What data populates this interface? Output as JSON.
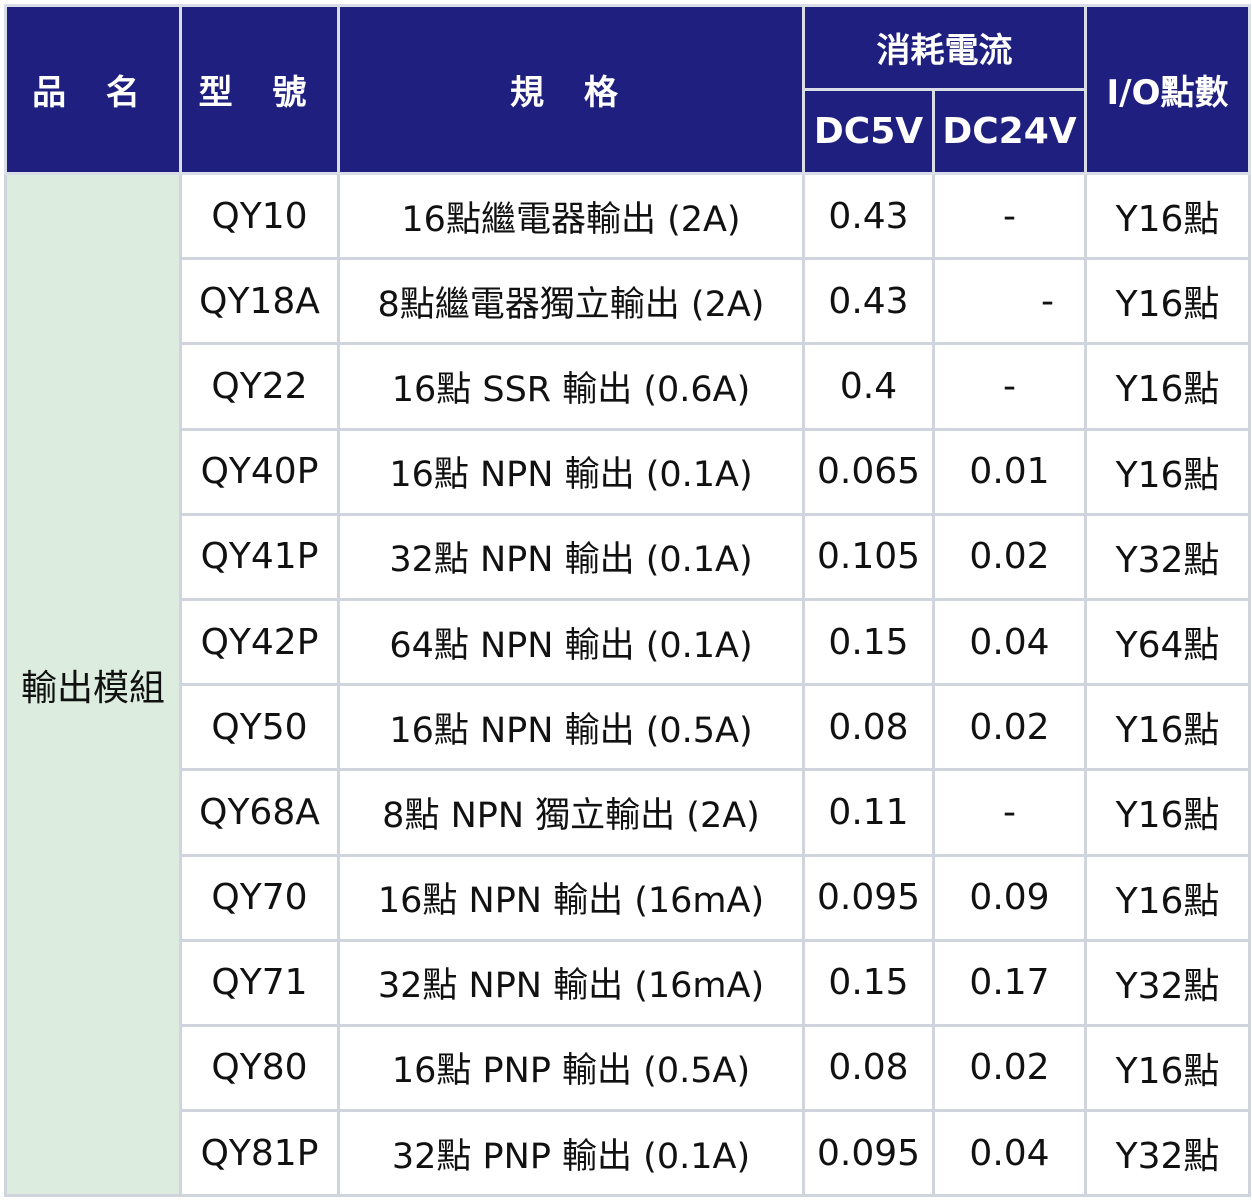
{
  "headers": {
    "product_name": "品 名",
    "model": "型 號",
    "spec": "規 格",
    "current": "消耗電流",
    "dc5v": "DC5V",
    "dc24v": "DC24V",
    "io_points": "I/O點數"
  },
  "category": "輸出模組",
  "rows": [
    {
      "model": "QY10",
      "spec": "16點繼電器輸出 (2A)",
      "dc5v": "0.43",
      "dc24v": "-",
      "io": "Y16點"
    },
    {
      "model": "QY18A",
      "spec": "8點繼電器獨立輸出  (2A)",
      "dc5v": "0.43",
      "dc24v": "-",
      "io": "Y16點"
    },
    {
      "model": "QY22",
      "spec": "16點 SSR 輸出 (0.6A)",
      "dc5v": "0.4",
      "dc24v": "-",
      "io": "Y16點"
    },
    {
      "model": "QY40P",
      "spec": "16點 NPN 輸出 (0.1A)",
      "dc5v": "0.065",
      "dc24v": "0.01",
      "io": "Y16點"
    },
    {
      "model": "QY41P",
      "spec": "32點 NPN 輸出 (0.1A)",
      "dc5v": "0.105",
      "dc24v": "0.02",
      "io": "Y32點"
    },
    {
      "model": "QY42P",
      "spec": "64點 NPN 輸出 (0.1A)",
      "dc5v": "0.15",
      "dc24v": "0.04",
      "io": "Y64點"
    },
    {
      "model": "QY50",
      "spec": "16點 NPN 輸出 (0.5A)",
      "dc5v": "0.08",
      "dc24v": "0.02",
      "io": "Y16點"
    },
    {
      "model": "QY68A",
      "spec": "8點 NPN 獨立輸出 (2A)",
      "dc5v": "0.11",
      "dc24v": "-",
      "io": "Y16點"
    },
    {
      "model": "QY70",
      "spec": "16點 NPN 輸出   (16mA)",
      "dc5v": "0.095",
      "dc24v": "0.09",
      "io": "Y16點"
    },
    {
      "model": "QY71",
      "spec": "32點 NPN 輸出 (16mA)",
      "dc5v": "0.15",
      "dc24v": "0.17",
      "io": "Y32點"
    },
    {
      "model": "QY80",
      "spec": "16點 PNP 輸出 (0.5A)",
      "dc5v": "0.08",
      "dc24v": "0.02",
      "io": "Y16點"
    },
    {
      "model": "QY81P",
      "spec": "32點 PNP 輸出 (0.1A)",
      "dc5v": "0.095",
      "dc24v": "0.04",
      "io": "Y32點"
    }
  ],
  "colors": {
    "header_bg": "#1f1f80",
    "header_text": "#ffffff",
    "category_bg": "#dcecdf",
    "grid": "#d0d5dd"
  }
}
